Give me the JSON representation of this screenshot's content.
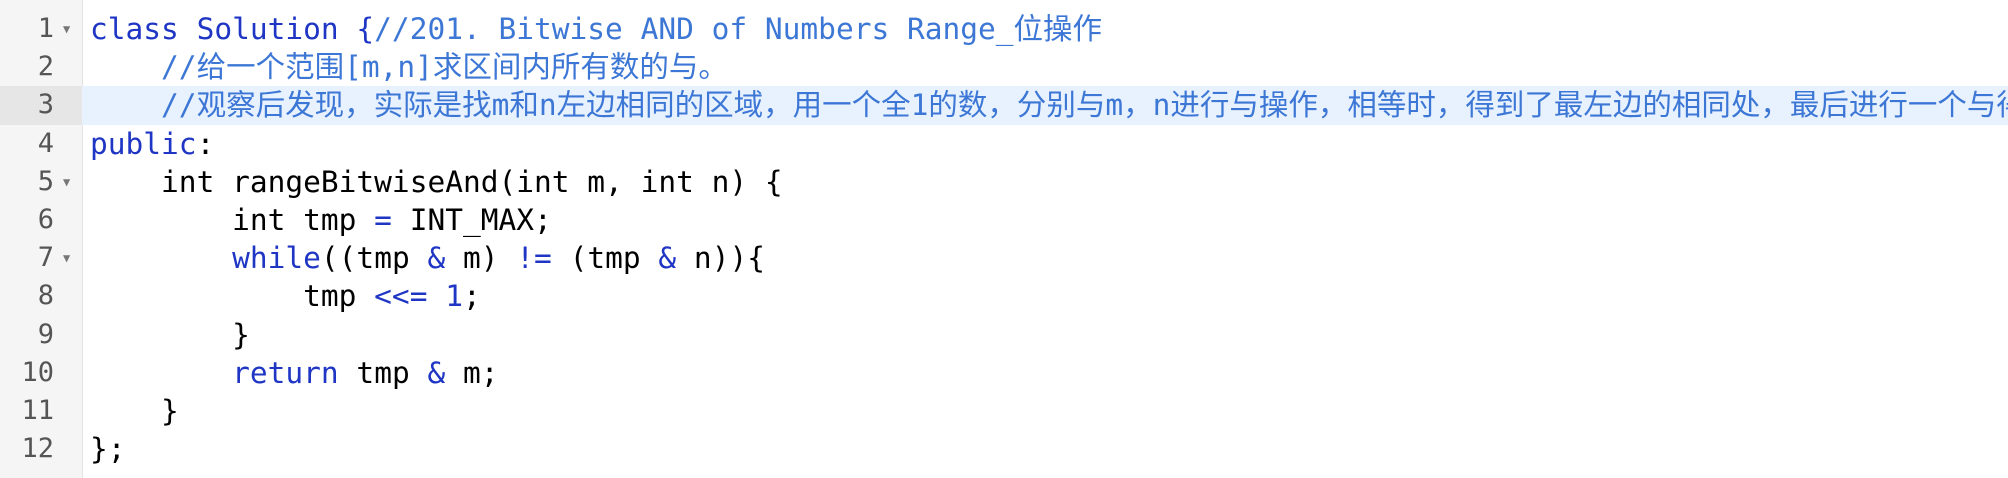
{
  "editor": {
    "lines": [
      {
        "number": "1",
        "fold": "▼",
        "tokens": [
          {
            "text": "class Solution {",
            "style": "kw"
          },
          {
            "text": "//201. Bitwise AND of Numbers Range_位操作",
            "style": "cm"
          }
        ]
      },
      {
        "number": "2",
        "fold": "",
        "tokens": [
          {
            "text": "    ",
            "style": ""
          },
          {
            "text": "//给一个范围[m,n]求区间内所有数的与。",
            "style": "cm"
          }
        ]
      },
      {
        "number": "3",
        "fold": "",
        "active": true,
        "tokens": [
          {
            "text": "    ",
            "style": ""
          },
          {
            "text": "//观察后发现，实际是找m和n左边相同的区域，用一个全1的数，分别与m，n进行与操作，相等时，得到了最左边的相同处，最后进行一个与得到结果",
            "style": "cm"
          }
        ]
      },
      {
        "number": "4",
        "fold": "",
        "tokens": [
          {
            "text": "public",
            "style": "kw"
          },
          {
            "text": ":",
            "style": ""
          }
        ]
      },
      {
        "number": "5",
        "fold": "▼",
        "tokens": [
          {
            "text": "    int rangeBitwiseAnd(int m, int n) {",
            "style": ""
          }
        ]
      },
      {
        "number": "6",
        "fold": "",
        "tokens": [
          {
            "text": "        int tmp ",
            "style": ""
          },
          {
            "text": "=",
            "style": "op"
          },
          {
            "text": " INT_MAX;",
            "style": ""
          }
        ]
      },
      {
        "number": "7",
        "fold": "▼",
        "tokens": [
          {
            "text": "        ",
            "style": ""
          },
          {
            "text": "while",
            "style": "kw"
          },
          {
            "text": "((tmp ",
            "style": ""
          },
          {
            "text": "&",
            "style": "op"
          },
          {
            "text": " m) ",
            "style": ""
          },
          {
            "text": "!=",
            "style": "op"
          },
          {
            "text": " (tmp ",
            "style": ""
          },
          {
            "text": "&",
            "style": "op"
          },
          {
            "text": " n)){",
            "style": ""
          }
        ]
      },
      {
        "number": "8",
        "fold": "",
        "tokens": [
          {
            "text": "            tmp ",
            "style": ""
          },
          {
            "text": "<<=",
            "style": "op"
          },
          {
            "text": " ",
            "style": ""
          },
          {
            "text": "1",
            "style": "nm"
          },
          {
            "text": ";",
            "style": ""
          }
        ]
      },
      {
        "number": "9",
        "fold": "",
        "tokens": [
          {
            "text": "        }",
            "style": ""
          }
        ]
      },
      {
        "number": "10",
        "fold": "",
        "tokens": [
          {
            "text": "        ",
            "style": ""
          },
          {
            "text": "return",
            "style": "kw"
          },
          {
            "text": " tmp ",
            "style": ""
          },
          {
            "text": "&",
            "style": "op"
          },
          {
            "text": " m;",
            "style": ""
          }
        ]
      },
      {
        "number": "11",
        "fold": "",
        "tokens": [
          {
            "text": "    }",
            "style": ""
          }
        ]
      },
      {
        "number": "12",
        "fold": "",
        "tokens": [
          {
            "text": "};",
            "style": ""
          }
        ]
      }
    ]
  }
}
